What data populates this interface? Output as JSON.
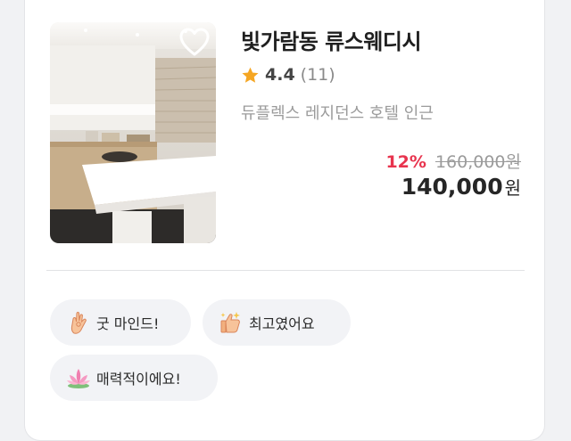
{
  "product": {
    "name": "빛가람동 류스웨디시",
    "rating": "4.4",
    "review_count": "(11)",
    "location": "듀플렉스 레지던스 호텔 인근",
    "discount_percent": "12%",
    "original_price": "160,000원",
    "price": "140,000",
    "price_unit": "원"
  },
  "tags": [
    {
      "label": "굿 마인드!",
      "icon": "hand-gesture-icon"
    },
    {
      "label": "최고였어요",
      "icon": "thumbs-up-icon"
    },
    {
      "label": "매력적이에요!",
      "icon": "lotus-icon"
    }
  ],
  "colors": {
    "discount": "#e8344e",
    "star": "#f5a623",
    "tag_background": "#f2f3f6"
  }
}
